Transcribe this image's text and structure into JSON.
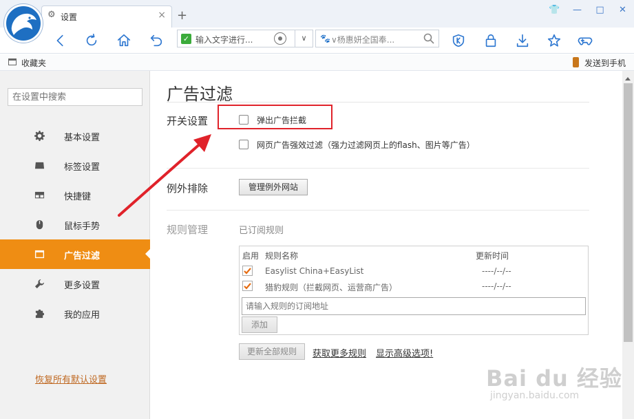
{
  "tab": {
    "title": "设置",
    "close_label": "×",
    "new_tab_label": "+"
  },
  "window": {
    "skin": "👕",
    "minimize": "—",
    "maximize": "□",
    "close": "✕"
  },
  "address": {
    "value": "输入文字进行...",
    "dropdown": "∨"
  },
  "search": {
    "paw": "🐾",
    "value": "∨杨惠妍全国奉..."
  },
  "bookmarks": {
    "favorites_label": "收藏夹",
    "send_to_phone": "发送到手机"
  },
  "sidebar": {
    "search_placeholder": "在设置中搜索",
    "items": [
      {
        "label": "基本设置",
        "icon": "gear-icon"
      },
      {
        "label": "标签设置",
        "icon": "tab-icon"
      },
      {
        "label": "快捷键",
        "icon": "keyboard-icon"
      },
      {
        "label": "鼠标手势",
        "icon": "mouse-icon"
      },
      {
        "label": "广告过滤",
        "icon": "window-icon",
        "active": true
      },
      {
        "label": "更多设置",
        "icon": "wrench-icon"
      },
      {
        "label": "我的应用",
        "icon": "puzzle-icon"
      }
    ],
    "restore_label": "恢复所有默认设置"
  },
  "content": {
    "title": "广告过滤",
    "switch_section": {
      "label": "开关设置",
      "options": [
        {
          "label": "弹出广告拦截",
          "checked": false
        },
        {
          "label": "网页广告强效过滤（强力过滤网页上的flash、图片等广告）",
          "checked": false
        }
      ]
    },
    "exception_section": {
      "label": "例外排除",
      "button": "管理例外网站"
    },
    "rules_section": {
      "label": "规则管理",
      "subscribed_label": "已订阅规则",
      "columns": {
        "enabled": "启用",
        "name": "规则名称",
        "updated": "更新时间"
      },
      "rows": [
        {
          "name": "Easylist China+EasyList",
          "updated": "----/--/--",
          "enabled": true
        },
        {
          "name": "猎豹规则（拦截网页、运营商广告）",
          "updated": "----/--/--",
          "enabled": true
        }
      ],
      "input_placeholder": "请输入规则的订阅地址",
      "add_button": "添加",
      "update_all_button": "更新全部规则",
      "more_rules_link": "获取更多规则",
      "advanced_link": "显示高级选项!"
    }
  },
  "watermark": {
    "main": "Bai du 经验",
    "sub": "jingyan.baidu.com"
  },
  "colors": {
    "accent": "#ef8d13",
    "highlight": "#e0222a",
    "link": "#c06a24",
    "icon_blue": "#2f78d1"
  }
}
